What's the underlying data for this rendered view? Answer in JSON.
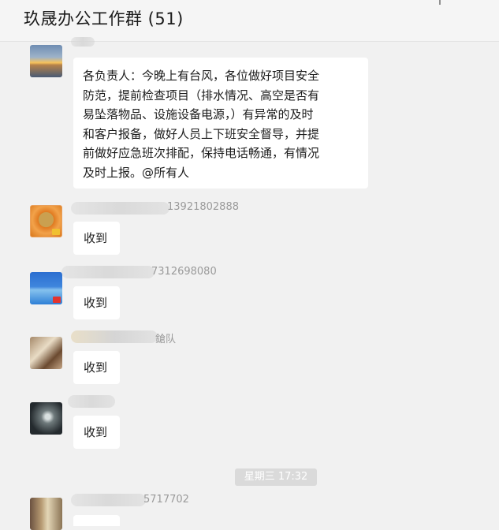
{
  "header": {
    "title": "玖晟办公工作群 (51)"
  },
  "messages": [
    {
      "sender": "",
      "lines": [
        "各负责人：今晚上有台风，各位做好项目安全",
        "防范，提前检查项目（排水情况、高空是否有",
        "易坠落物品、设施设备电源，）有异常的及时",
        "和客户报备，做好人员上下班安全督导，并提",
        "前做好应急班次排配，保持电话畅通，有情况",
        "及时上报。@所有人"
      ]
    },
    {
      "sender": "13921802888",
      "text": "收到"
    },
    {
      "sender": "7312698080",
      "text": "收到"
    },
    {
      "sender": "鎗队",
      "text": "收到"
    },
    {
      "sender": "",
      "text": "收到"
    },
    {
      "sender": "5717702",
      "text": ""
    }
  ],
  "time_divider": "星期三 17:32"
}
